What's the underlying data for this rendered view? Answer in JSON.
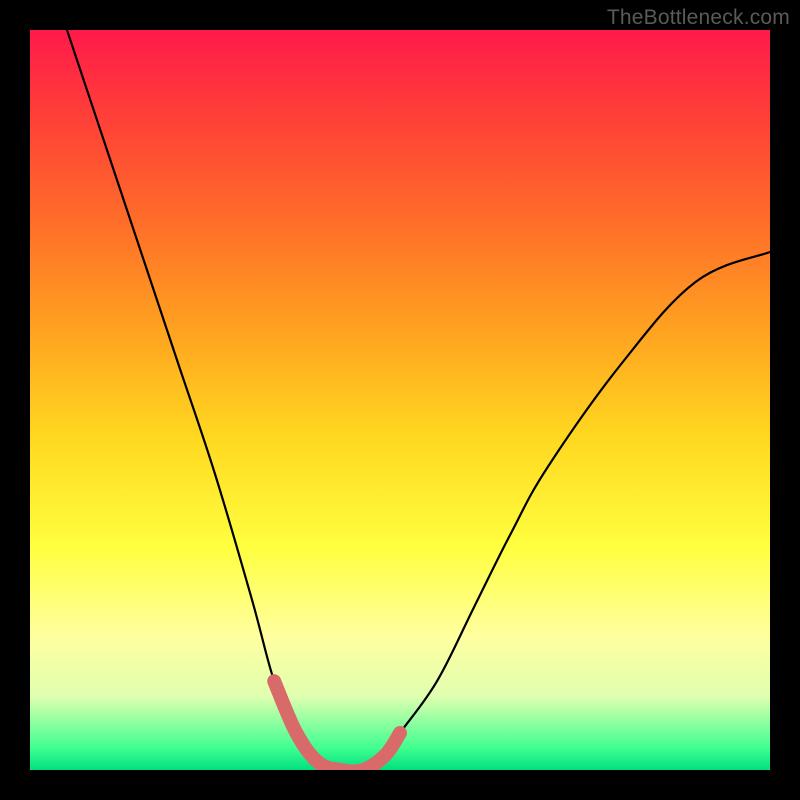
{
  "watermark": "TheBottleneck.com",
  "chart_data": {
    "type": "line",
    "title": "",
    "xlabel": "",
    "ylabel": "",
    "xlim": [
      0,
      100
    ],
    "ylim": [
      0,
      100
    ],
    "grid": false,
    "series": [
      {
        "name": "bottleneck-curve",
        "x": [
          5,
          10,
          15,
          20,
          25,
          30,
          33,
          36,
          39,
          42,
          45,
          48,
          50,
          55,
          60,
          65,
          70,
          80,
          90,
          100
        ],
        "y": [
          100,
          85,
          70,
          55,
          40,
          23,
          12,
          5,
          1,
          0,
          0,
          2,
          5,
          12,
          22,
          32,
          41,
          55,
          66,
          70
        ],
        "color": "#000000"
      },
      {
        "name": "optimal-range",
        "x": [
          33,
          36,
          39,
          42,
          45,
          48,
          50
        ],
        "y": [
          12,
          5,
          1,
          0,
          0,
          2,
          5
        ],
        "color": "#d96a6a"
      }
    ],
    "gradient_stops": [
      {
        "pos": 0.0,
        "color": "#ff1a4a"
      },
      {
        "pos": 0.7,
        "color": "#ffff40"
      },
      {
        "pos": 0.97,
        "color": "#40ff90"
      },
      {
        "pos": 1.0,
        "color": "#00e080"
      }
    ]
  }
}
